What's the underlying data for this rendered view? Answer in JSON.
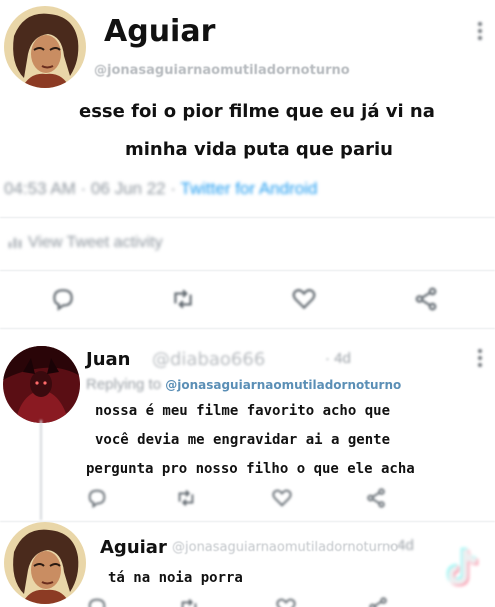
{
  "main_tweet": {
    "author_name": "Aguiar",
    "author_handle": "@jonasaguiarnaomutiladornoturno",
    "text_line1": "esse foi o pior filme que eu já vi na",
    "text_line2": "minha vida puta que pariu",
    "timestamp": "04:53 AM · 06 Jun 22 · ",
    "source": "Twitter for Android",
    "activity_label": "View Tweet activity"
  },
  "reply1": {
    "author_name": "Juan",
    "author_handle": "@diabao666",
    "time": "· 4d",
    "replying_label": "Replying to ",
    "replying_handle": "@jonasaguiarnaomutiladornoturno",
    "text_line1": "nossa é meu filme favorito acho que",
    "text_line2": "você devia me engravidar ai a gente",
    "text_line3": "pergunta pro nosso filho o que ele acha"
  },
  "reply2": {
    "author_name": "Aguiar",
    "author_handle": "@jonasaguiarnaomutiladornoturno",
    "time": "· 4d",
    "text": "tá na noia porra"
  },
  "icons": [
    "reply-icon",
    "retweet-icon",
    "like-icon",
    "share-icon",
    "more-icon",
    "tiktok-logo-icon"
  ],
  "colors": {
    "link_blue": "#1d9bf0",
    "muted_gray": "#8e969e",
    "text_dark": "#111111"
  }
}
